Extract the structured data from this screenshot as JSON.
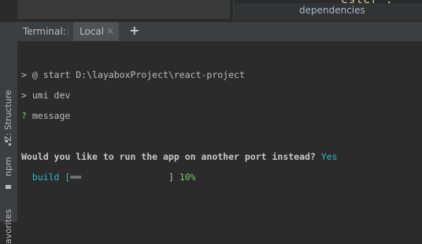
{
  "top": {
    "panel_label": "dependencies",
    "code_peek": "\"ester\":"
  },
  "left_strip": {
    "structure_label": "Z: Structure",
    "npm_label": "npm",
    "favorites_label": "avorites"
  },
  "terminal": {
    "tab_title": "Terminal:",
    "tabs": [
      {
        "label": "Local",
        "close": "×"
      }
    ],
    "add_tab": "+",
    "lines": {
      "l1": {
        "prompt": "> ",
        "text": "@ start D:\\layaboxProject\\react-project"
      },
      "l2": {
        "prompt": "> ",
        "text": "umi dev"
      },
      "l3": {
        "prompt": "? ",
        "text": "message"
      },
      "l4": {
        "question": "Would you like to run the app on another port instead? ",
        "answer": "Yes"
      },
      "l5": {
        "label": "  build [",
        "progress_bar": "══",
        "spacer": "                ",
        "end": "] ",
        "percent": "10%"
      }
    }
  },
  "progress": {
    "build": 0.1
  },
  "colors": {
    "background": "#2b2b2b",
    "accent_cyan": "#2fb5c7",
    "accent_green": "#7ec26c",
    "text": "#bbbbbb"
  }
}
